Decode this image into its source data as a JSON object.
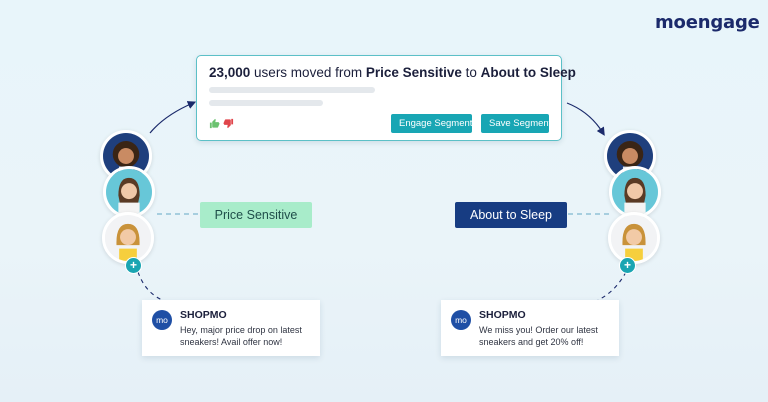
{
  "brand": {
    "logo_text": "moengage"
  },
  "insight": {
    "count": "23,000",
    "text_middle": " users moved from ",
    "from_segment": "Price Sensitive",
    "text_connector": " to ",
    "to_segment": "About to Sleep",
    "engage_button": "Engage Segment",
    "save_button": "Save Segment",
    "thumbs_up_icon": "thumbs-up-icon",
    "thumbs_down_icon": "thumbs-down-icon"
  },
  "segments": {
    "left_label": "Price Sensitive",
    "right_label": "About to Sleep"
  },
  "notifications": [
    {
      "logo": "mo",
      "brand": "SHOPMO",
      "message": "Hey, major price drop on latest sneakers! Avail offer now!"
    },
    {
      "logo": "mo",
      "brand": "SHOPMO",
      "message": "We miss you! Order our latest sneakers and get 20% off!"
    }
  ],
  "colors": {
    "accent_teal": "#18a6b4",
    "segment_green": "#a8ecca",
    "segment_navy": "#173c82",
    "brand_navy": "#1b2a6b"
  }
}
